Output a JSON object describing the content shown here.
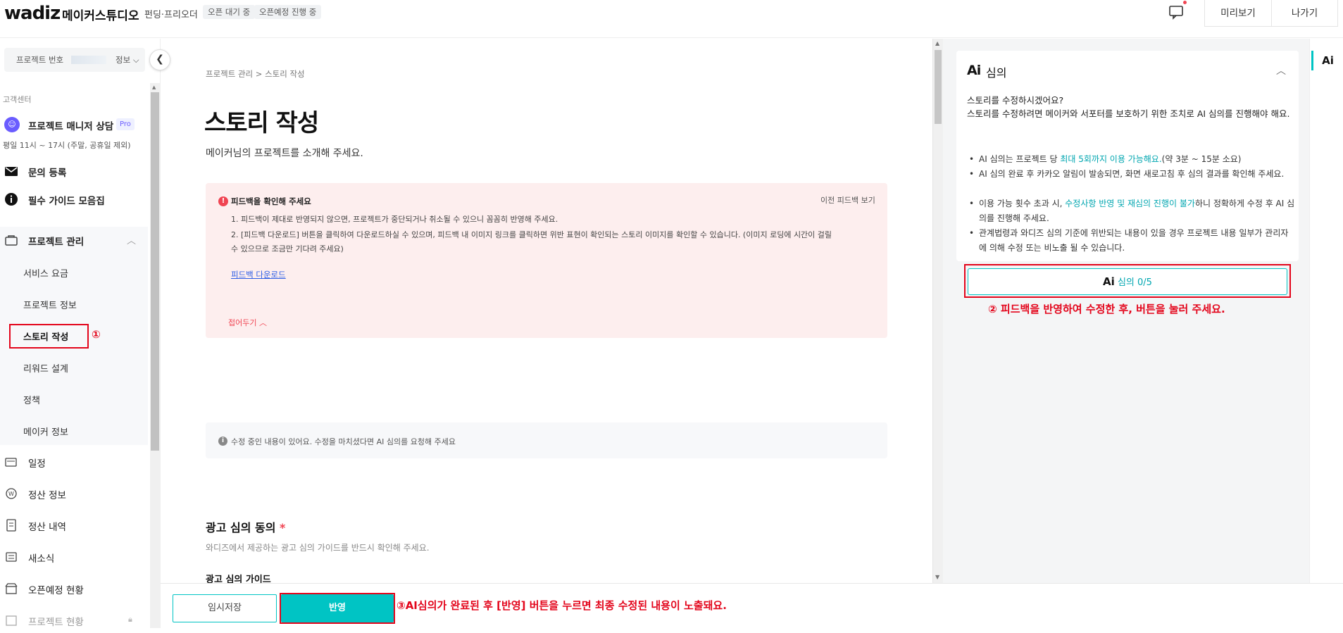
{
  "header": {
    "logo": "wadiz",
    "studio": "메이커스튜디오",
    "mode": "펀딩·프리오더",
    "chips": [
      "오픈 대기 중",
      "오픈예정 진행 중"
    ],
    "preview_label": "미리보기",
    "exit_label": "나가기"
  },
  "sidebar": {
    "project_select_label": "프로젝트 번호",
    "project_select_info": "정보",
    "customer_center": "고객센터",
    "pm_title": "프로젝트 매니저 상담",
    "pm_badge": "Pro",
    "pm_hours": "평일 11시 ~ 17시 (주말, 공휴일 제외)",
    "inquiry": "문의 등록",
    "guide": "필수 가이드 모음집",
    "project_manage": "프로젝트 관리",
    "sub_items": [
      "서비스 요금",
      "프로젝트 정보",
      "스토리 작성",
      "리워드 설계",
      "정책",
      "메이커 정보"
    ],
    "bottom_items": [
      "일정",
      "정산 정보",
      "정산 내역",
      "새소식",
      "오픈예정 현황",
      "프로젝트 현황"
    ],
    "note1": "①"
  },
  "main": {
    "breadcrumb": "프로젝트 관리 > 스토리 작성",
    "title": "스토리 작성",
    "subtitle": "메이커님의 프로젝트를 소개해 주세요.",
    "feedback": {
      "title": "피드백을 확인해 주세요",
      "prev_link": "이전 피드백 보기",
      "line1": "1. 피드백이 제대로 반영되지 않으면, 프로젝트가 중단되거나 취소될 수 있으니 꼼꼼히 반영해 주세요.",
      "line2": "2. [피드백 다운로드] 버튼을 클릭하여 다운로드하실 수 있으며, 피드백 내 이미지 링크를 클릭하면 위반 표현이 확인되는 스토리 이미지를 확인할 수 있습니다. (이미지 로딩에 시간이 걸릴 수 있으므로 조금만 기다려 주세요)",
      "download": "피드백 다운로드",
      "fold": "접어두기"
    },
    "info_text": "수정 중인 내용이 있어요. 수정을 마치셨다면 AI 심의를 요청해 주세요",
    "ad_title": "광고 심의 동의",
    "ad_star": "*",
    "ad_sub": "와디즈에서 제공하는 광고 심의 가이드를 반드시 확인해 주세요.",
    "ad_guide": "광고 심의 가이드"
  },
  "bottom": {
    "save_label": "임시저장",
    "apply_label": "반영",
    "note3": "③AI심의가 완료된 후 [반영] 버튼을 누르면 최종 수정된 내용이 노출돼요."
  },
  "ai_panel": {
    "logo": "Ai",
    "title": "심의",
    "question": "스토리를 수정하시겠어요?",
    "desc": "스토리를 수정하려면 메이커와 서포터를 보호하기 위한 조치로 AI 심의를 진행해야 해요.",
    "b1_pre": "AI 심의는 프로젝트 당 ",
    "b1_hl": "최대 5회까지 이용 가능해요.",
    "b1_post": "(약 3분 ~ 15분 소요)",
    "b2": "AI 심의 완료 후 카카오 알림이 발송되면, 화면 새로고침 후 심의 결과를 확인해 주세요.",
    "b3_pre": "이용 가능 횟수 초과 시, ",
    "b3_hl": "수정사항 반영 및 재심의 진행이 불가",
    "b3_post": "하니 정확하게 수정 후 AI 심의를 진행해 주세요.",
    "b4": "관계법령과 와디즈 심의 기준에 위반되는 내용이 있을 경우 프로젝트 내용 일부가 관리자에 의해 수정 또는 비노출 될 수 있습니다.",
    "button_ai": "Ai",
    "button_label": "심의 0/5",
    "note2": "② 피드백을 반영하여 수정한 후, 버튼을 눌러 주세요."
  },
  "rail": {
    "tab": "Ai"
  },
  "colors": {
    "accent": "#00c4c4",
    "annotation": "#e3051b",
    "feedback_bg": "#fdeeee"
  }
}
